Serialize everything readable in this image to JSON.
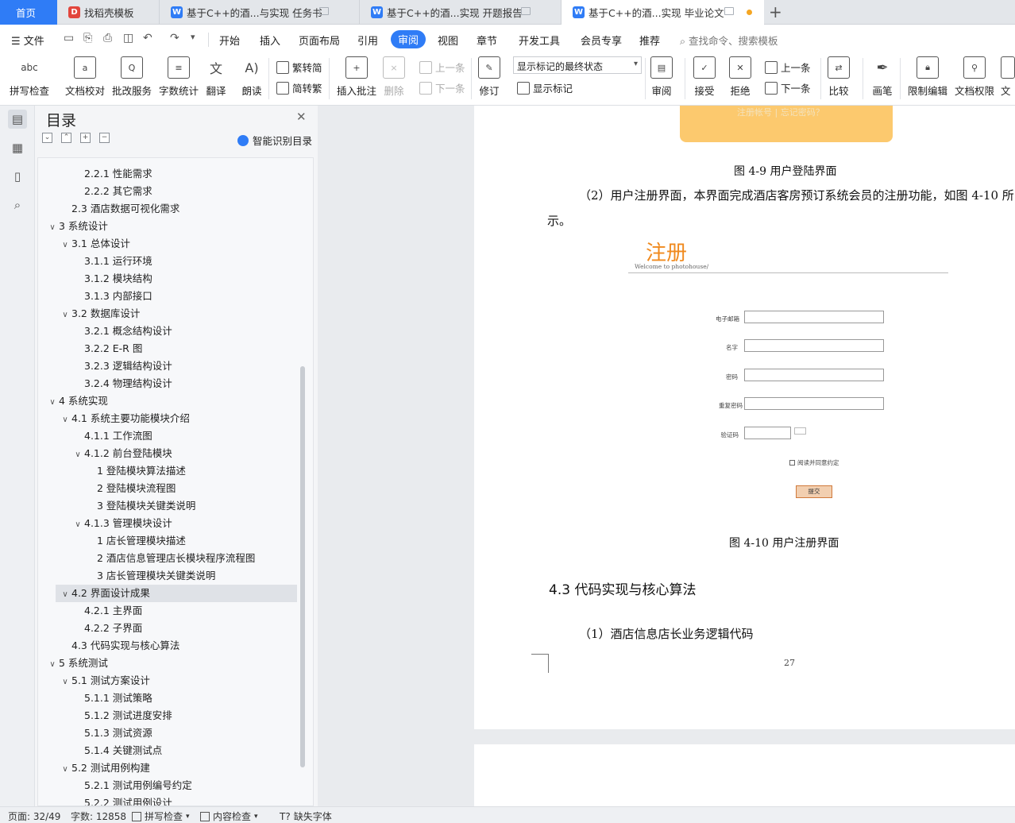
{
  "tabs": {
    "home": "首页",
    "t1": "找稻壳模板",
    "t2": "基于C++的酒...与实现 任务书",
    "t3": "基于C++的酒...实现 开题报告",
    "t4": "基于C++的酒...实现 毕业论文",
    "new_tab": "+"
  },
  "menu": {
    "file": "文件",
    "items": [
      "开始",
      "插入",
      "页面布局",
      "引用",
      "审阅",
      "视图",
      "章节",
      "开发工具",
      "会员专享",
      "推荐"
    ],
    "active": "审阅",
    "search_placeholder": "查找命令、搜索模板"
  },
  "ribbon": {
    "spell": "拼写检查",
    "proof": "文档校对",
    "review_service": "批改服务",
    "word_count": "字数统计",
    "translate": "翻译",
    "read_aloud": "朗读",
    "to_simplified": "繁转简",
    "to_traditional": "简转繁",
    "insert_comment": "插入批注",
    "delete": "删除",
    "prev_comment": "上一条",
    "next_comment": "下一条",
    "track_changes": "修订",
    "markup_combo": "显示标记的最终状态",
    "show_markup": "显示标记",
    "review": "审阅",
    "accept": "接受",
    "reject": "拒绝",
    "prev_change": "上一条",
    "next_change": "下一条",
    "compare": "比较",
    "pen": "画笔",
    "restrict_edit": "限制编辑",
    "doc_permission": "文档权限",
    "doc_more": "文"
  },
  "toc": {
    "title": "目录",
    "smart": "智能识别目录",
    "items": [
      {
        "text": "2.2.1  性能需求",
        "level": 3,
        "arrow": ""
      },
      {
        "text": "2.2.2  其它需求",
        "level": 3,
        "arrow": ""
      },
      {
        "text": "2.3  酒店数据可视化需求",
        "level": 2,
        "arrow": ""
      },
      {
        "text": "3  系统设计",
        "level": 1,
        "arrow": "v"
      },
      {
        "text": "3.1  总体设计",
        "level": 2,
        "arrow": "v"
      },
      {
        "text": "3.1.1 运行环境",
        "level": 3,
        "arrow": ""
      },
      {
        "text": "3.1.2 模块结构",
        "level": 3,
        "arrow": ""
      },
      {
        "text": "3.1.3 内部接口",
        "level": 3,
        "arrow": ""
      },
      {
        "text": "3.2  数据库设计",
        "level": 2,
        "arrow": "v"
      },
      {
        "text": "3.2.1  概念结构设计",
        "level": 3,
        "arrow": ""
      },
      {
        "text": "3.2.2 E-R 图",
        "level": 3,
        "arrow": ""
      },
      {
        "text": "3.2.3  逻辑结构设计",
        "level": 3,
        "arrow": ""
      },
      {
        "text": "3.2.4  物理结构设计",
        "level": 3,
        "arrow": ""
      },
      {
        "text": "4  系统实现",
        "level": 1,
        "arrow": "v"
      },
      {
        "text": "4.1  系统主要功能模块介绍",
        "level": 2,
        "arrow": "v"
      },
      {
        "text": "4.1.1  工作流图",
        "level": 3,
        "arrow": ""
      },
      {
        "text": "4.1.2  前台登陆模块",
        "level": 3,
        "arrow": "v"
      },
      {
        "text": "1 登陆模块算法描述",
        "level": 4,
        "arrow": ""
      },
      {
        "text": "2  登陆模块流程图",
        "level": 4,
        "arrow": ""
      },
      {
        "text": "3 登陆模块关键类说明",
        "level": 4,
        "arrow": ""
      },
      {
        "text": "4.1.3 管理模块设计",
        "level": 3,
        "arrow": "v"
      },
      {
        "text": "1 店长管理模块描述",
        "level": 4,
        "arrow": ""
      },
      {
        "text": "2 酒店信息管理店长模块程序流程图",
        "level": 4,
        "arrow": ""
      },
      {
        "text": "3 店长管理模块关键类说明",
        "level": 4,
        "arrow": ""
      },
      {
        "text": "4.2  界面设计成果",
        "level": 2,
        "arrow": "v",
        "selected": true
      },
      {
        "text": "4.2.1  主界面",
        "level": 3,
        "arrow": ""
      },
      {
        "text": "4.2.2  子界面",
        "level": 3,
        "arrow": ""
      },
      {
        "text": "4.3  代码实现与核心算法",
        "level": 2,
        "arrow": ""
      },
      {
        "text": "5  系统测试",
        "level": 1,
        "arrow": "v"
      },
      {
        "text": "5.1  测试方案设计",
        "level": 2,
        "arrow": "v"
      },
      {
        "text": "5.1.1  测试策略",
        "level": 3,
        "arrow": ""
      },
      {
        "text": "5.1.2  测试进度安排",
        "level": 3,
        "arrow": ""
      },
      {
        "text": "5.1.3  测试资源",
        "level": 3,
        "arrow": ""
      },
      {
        "text": "5.1.4  关键测试点",
        "level": 3,
        "arrow": ""
      },
      {
        "text": "5.2  测试用例构建",
        "level": 2,
        "arrow": "v"
      },
      {
        "text": "5.2.1  测试用例编号约定",
        "level": 3,
        "arrow": ""
      },
      {
        "text": "5.2.2  测试用例设计",
        "level": 3,
        "arrow": ""
      }
    ]
  },
  "doc": {
    "login_links": "注册帐号    |    忘记密码？",
    "fig49_caption": "图 4-9 用户登陆界面",
    "para1_line1": "（2）用户注册界面，本界面完成酒店客房预订系统会员的注册功能，如图 4-10 所",
    "para1_line2": "示。",
    "form_title": "注册",
    "form_subtitle": "Welcome to photohouse/",
    "form_labels": [
      "电子邮箱",
      "名字",
      "密码",
      "重复密码",
      "验证码"
    ],
    "form_agree": "阅读并同意约定",
    "form_submit": "提交",
    "fig410_caption": "图 4-10  用户注册界面",
    "heading": "4.3 代码实现与核心算法",
    "para2": "（1）酒店信息店长业务逻辑代码",
    "page_number": "27"
  },
  "status": {
    "page": "页面: 32/49",
    "words": "字数: 12858",
    "spell": "拼写检查",
    "content": "内容检查",
    "missing_font": "缺失字体"
  },
  "colors": {
    "accent": "#2f7cf6",
    "form_title": "#f08a1e",
    "login_panel": "#fcc96e",
    "modified_dot": "#f5a623"
  }
}
